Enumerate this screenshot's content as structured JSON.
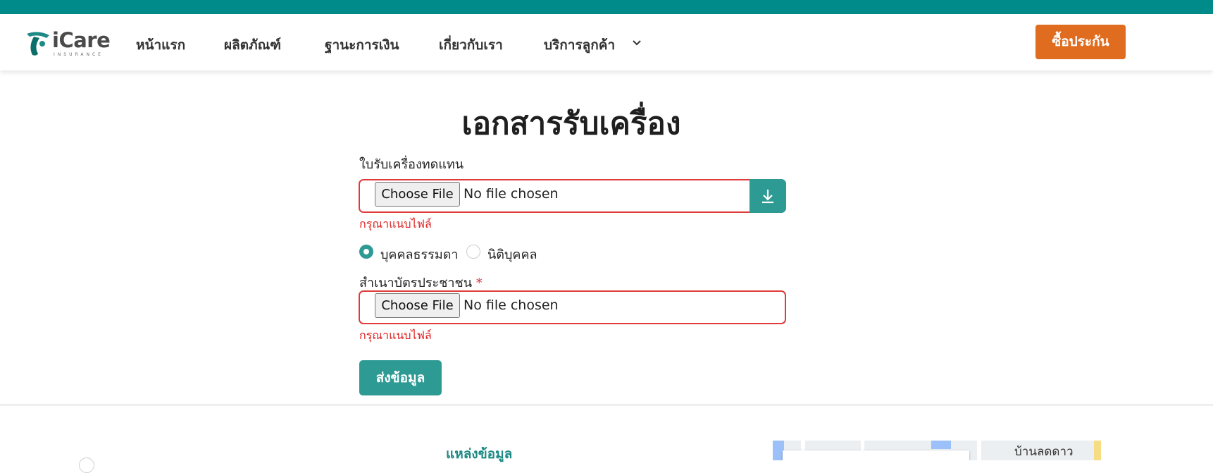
{
  "brand": {
    "logo_text": "iCare",
    "logo_sub": "INSURANCE",
    "teal": "#008b8b",
    "accent_orange": "#e06c1f",
    "button_teal": "#2e9a94"
  },
  "nav": {
    "items": [
      {
        "label": "หน้าแรก"
      },
      {
        "label": "ผลิตภัณฑ์"
      },
      {
        "label": "ฐานะการเงิน"
      },
      {
        "label": "เกี่ยวกับเรา"
      },
      {
        "label": "บริการลูกค้า",
        "icon": "chevron-down-icon"
      }
    ],
    "cta_label": "ซื้อประกัน"
  },
  "form": {
    "title": "เอกสารรับเครื่อง",
    "replacement_receipt": {
      "label": "ใบรับเครื่องทดแทน",
      "choose_label": "Choose File",
      "status": "No file chosen",
      "download_icon": "download-icon",
      "error": "กรุณาแนบไฟล์"
    },
    "person_type": {
      "options": [
        {
          "label": "บุคคลธรรมดา",
          "selected": true
        },
        {
          "label": "นิติบุคคล",
          "selected": false
        }
      ]
    },
    "id_copy": {
      "label": "สำเนาบัตรประชาชน",
      "required_mark": "*",
      "choose_label": "Choose File",
      "status": "No file chosen",
      "error": "กรุณาแนบไฟล์"
    },
    "submit_label": "ส่งข้อมูล"
  },
  "footer": {
    "section_heading": "แหล่งข้อมูล",
    "map_label": "บ้านลดดาว"
  }
}
